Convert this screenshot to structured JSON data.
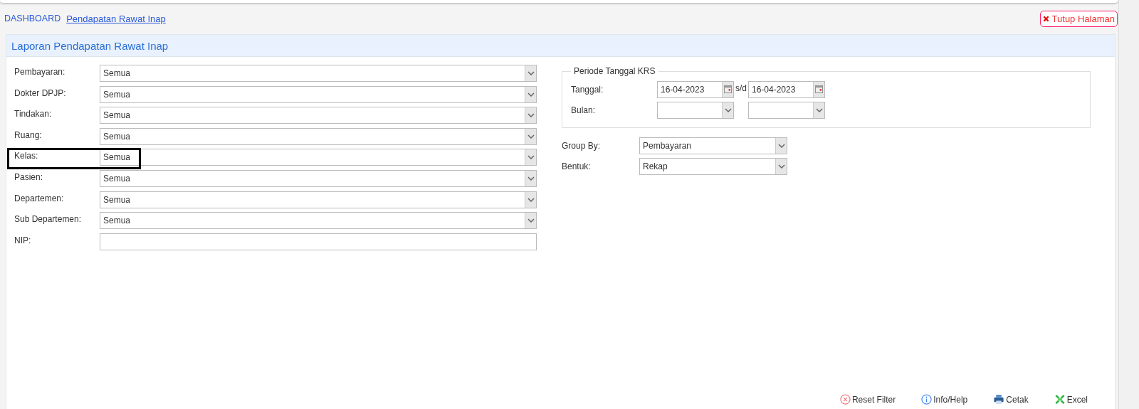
{
  "breadcrumb": [
    {
      "label": "DASHBOARD",
      "current": false
    },
    {
      "label": "Pendapatan Rawat Inap",
      "current": true
    }
  ],
  "close_button": {
    "label": "Tutup Halaman"
  },
  "panel": {
    "title": "Laporan Pendapatan Rawat Inap"
  },
  "filters": [
    {
      "kind": "select",
      "label": "Pembayaran:",
      "value": "Semua",
      "highlighted": false
    },
    {
      "kind": "select",
      "label": "Dokter DPJP:",
      "value": "Semua",
      "highlighted": false
    },
    {
      "kind": "select",
      "label": "Tindakan:",
      "value": "Semua",
      "highlighted": false
    },
    {
      "kind": "select",
      "label": "Ruang:",
      "value": "Semua",
      "highlighted": false
    },
    {
      "kind": "select",
      "label": "Kelas:",
      "value": "Semua",
      "highlighted": true
    },
    {
      "kind": "select",
      "label": "Pasien:",
      "value": "Semua",
      "highlighted": false
    },
    {
      "kind": "select",
      "label": "Departemen:",
      "value": "Semua",
      "highlighted": false
    },
    {
      "kind": "select",
      "label": "Sub Departemen:",
      "value": "Semua",
      "highlighted": false
    },
    {
      "kind": "text",
      "label": "NIP:",
      "highlighted": false
    }
  ],
  "period": {
    "legend": "Periode Tanggal KRS",
    "date_label": "Tanggal:",
    "date_from": "16-04-2023",
    "separator": "s/d",
    "date_to": "16-04-2023",
    "month_label": "Bulan:"
  },
  "options": [
    {
      "label": "Group By:",
      "value": "Pembayaran"
    },
    {
      "label": "Bentuk:",
      "value": "Rekap"
    }
  ],
  "actions": [
    {
      "kind": "reset",
      "label": "Reset Filter"
    },
    {
      "kind": "info",
      "label": "Info/Help"
    },
    {
      "kind": "print",
      "label": "Cetak"
    },
    {
      "kind": "excel",
      "label": "Excel"
    }
  ]
}
